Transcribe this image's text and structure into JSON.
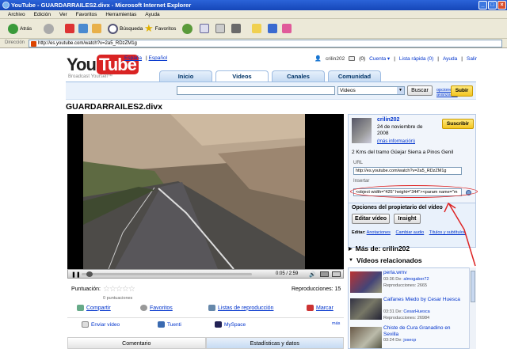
{
  "window": {
    "title": "YouTube - GUARDARRAILES2.divx - Microsoft Internet Explorer"
  },
  "menu": [
    "Archivo",
    "Edición",
    "Ver",
    "Favoritos",
    "Herramientas",
    "Ayuda"
  ],
  "toolbar": {
    "back": "Atrás",
    "search": "Búsqueda",
    "favorites": "Favoritos"
  },
  "address": {
    "label": "Dirección",
    "url": "http://es.youtube.com/watch?v=2a5_RDzZM1g"
  },
  "header": {
    "logo_you": "You",
    "logo_tube": "Tube",
    "tagline": "Broadcast Yourself™",
    "locale_country": "España",
    "locale_lang": "Español",
    "username": "crilin202",
    "inbox_count": "(0)",
    "account": "Cuenta ▾",
    "quicklist": "Lista rápida (0)",
    "help": "Ayuda",
    "logout": "Salir"
  },
  "tabs": [
    "Inicio",
    "Videos",
    "Canales",
    "Comunidad"
  ],
  "search": {
    "category": "Videos",
    "button": "Buscar",
    "advanced": "opciones avanzadas",
    "upload": "Subir"
  },
  "video": {
    "title": "GUARDARRAILES2.divx",
    "time": "0:05 / 2:59",
    "progress_fraction": 0.03,
    "rating_label": "Puntuación:",
    "rating_count": "0 puntuaciones",
    "views_label": "Reproducciones:",
    "views": "15",
    "actions": {
      "share": "Compartir",
      "favorites": "Favoritos",
      "playlists": "Listas de reproducción",
      "flag": "Marcar"
    },
    "share": {
      "send": "Enviar vídeo",
      "tuenti": "Tuenti",
      "myspace": "MySpace",
      "more": "más"
    },
    "bottom_tabs": [
      "Comentario",
      "Estadísticas y datos"
    ]
  },
  "info": {
    "uploader": "crilin202",
    "date": "24 de noviembre de 2008",
    "more_info": "(más información)",
    "subscribe": "Suscribir",
    "description": "2 Kms del tramo Güejar Sierra a Pinos Genil",
    "url_label": "URL",
    "url_value": "http://es.youtube.com/watch?v=2a5_RDzZM1g",
    "embed_label": "Insertar",
    "embed_value": "<object width=\"425\" height=\"344\"><param name=\"m"
  },
  "owner": {
    "title": "Opciones del propietario del vídeo",
    "edit": "Editar vídeo",
    "insight": "Insight",
    "edit_label": "Editar:",
    "links": [
      "Anotaciones",
      "Cambiar audio",
      "Títulos y subtítulos"
    ]
  },
  "more_from": "Más de: crilin202",
  "related_title": "Vídeos relacionados",
  "related": [
    {
      "title": "perla.wmv",
      "meta1_time": "03:36",
      "meta1_user": "almogaber72",
      "meta2": "Reproducciones: 2665"
    },
    {
      "title": "Caifanes Miedo by Cesar Huesca",
      "meta1_time": "03:31",
      "meta1_user": "CesarHuesca",
      "meta2": "Reproducciones: 26984"
    },
    {
      "title": "Chiste de Cura Granadino en Sevilla",
      "meta1_time": "03:24",
      "meta1_user": "josecp",
      "meta2": ""
    }
  ],
  "related_de": "De:",
  "colors": {
    "youtube_red": "#d92323",
    "link_blue": "#0033cc",
    "xp_titlebar": "#1f52c8",
    "annotation_red": "#dd2222"
  }
}
